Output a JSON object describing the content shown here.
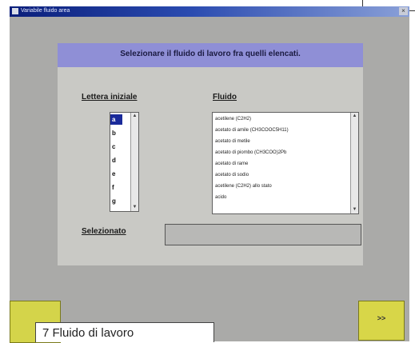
{
  "window": {
    "title": "Variabile fluido area"
  },
  "banner": {
    "text": "Selezionare il fluido di lavoro fra quelli elencati."
  },
  "labels": {
    "letter": "Lettera iniziale",
    "fluid": "Fluido",
    "selected": "Selezionato"
  },
  "letters": {
    "items": [
      "a",
      "b",
      "c",
      "d",
      "e",
      "f",
      "g"
    ],
    "selected": "a"
  },
  "fluids": {
    "items": [
      "acetilene (C2H2)",
      "acetato di amile (CH3COOC5H11)",
      "acetato di metile",
      "acetato di piombo (CH3COO)2Pb",
      "acetato di rame",
      "acetato di sodio",
      "acetilene (C2H2) allo stato",
      "acido"
    ]
  },
  "selection": {
    "value": ""
  },
  "nav": {
    "next_label": ">>"
  },
  "caption": {
    "text": "7 Fluido di lavoro"
  },
  "colors": {
    "banner": "#8f8fd6",
    "panel": "#c9c9c5",
    "window": "#aaaaa8",
    "yellow": "#d4d44a",
    "titlebar": "#0a1e7a"
  }
}
